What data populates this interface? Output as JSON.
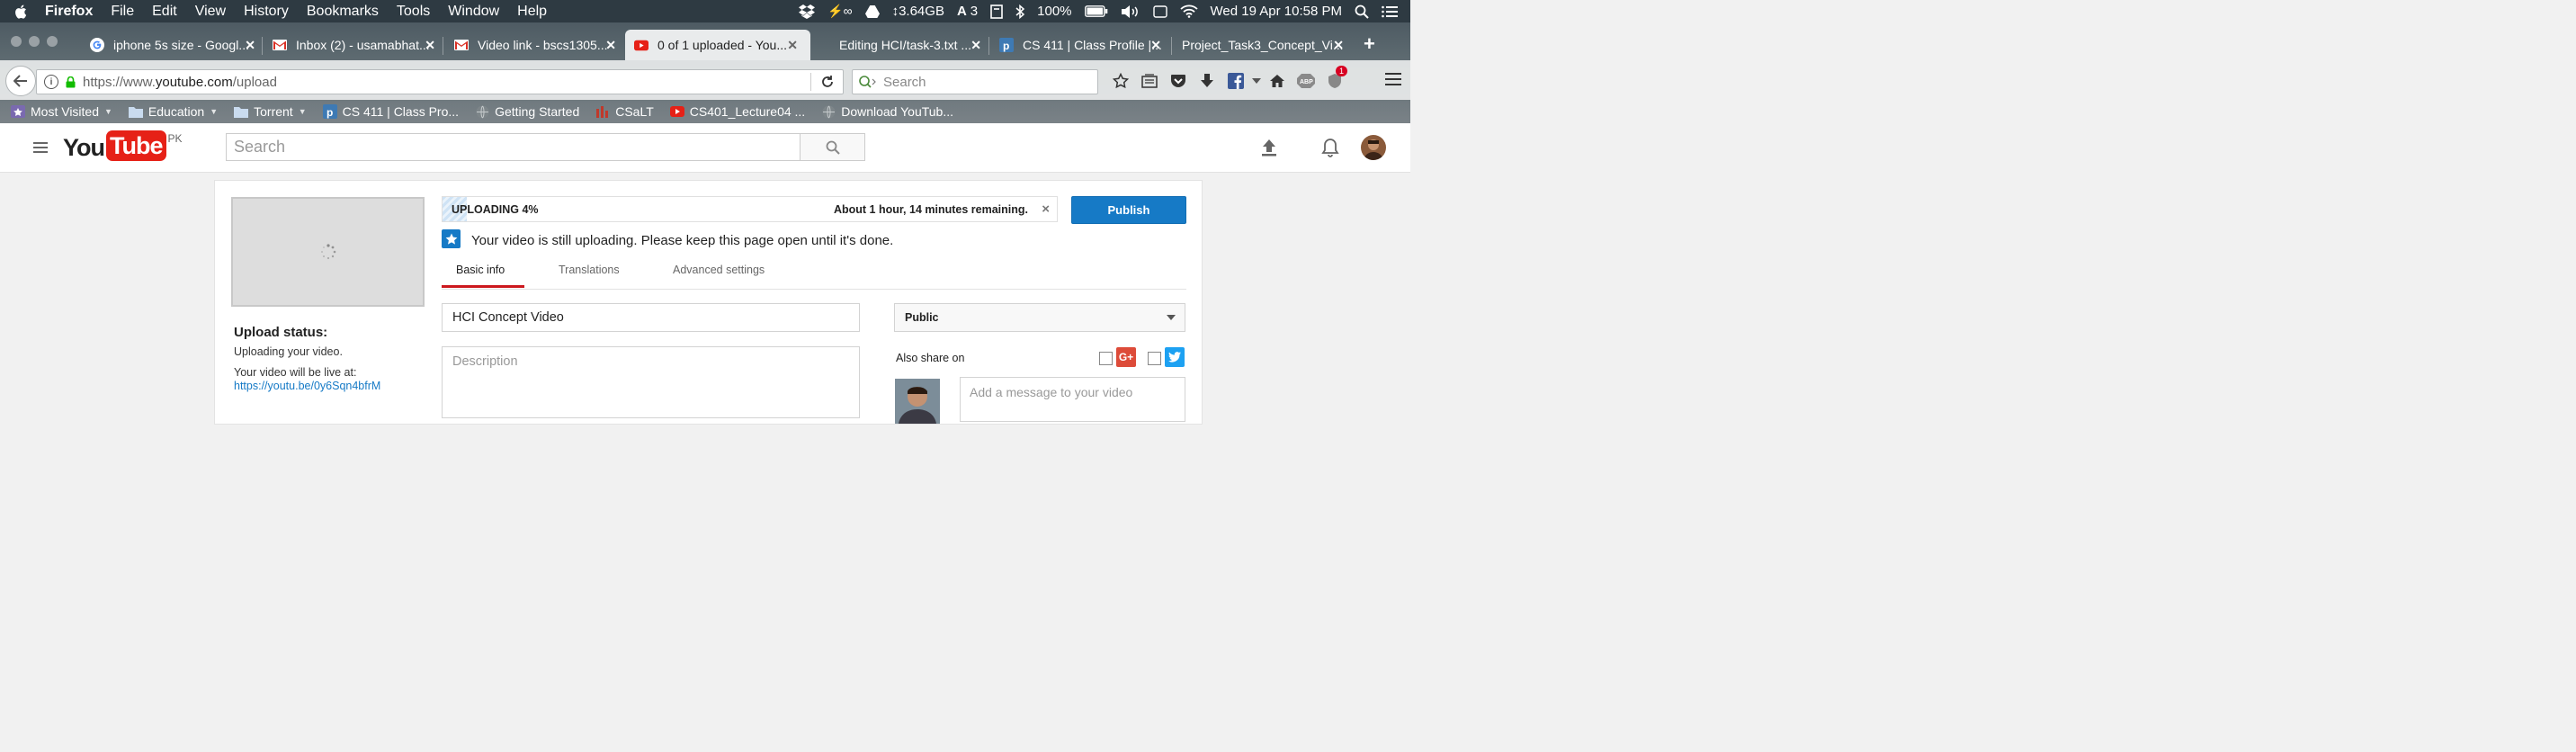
{
  "menubar": {
    "app": "Firefox",
    "items": [
      "File",
      "Edit",
      "View",
      "History",
      "Bookmarks",
      "Tools",
      "Window",
      "Help"
    ],
    "status": {
      "data_rate": "↕3.64GB",
      "adobe_count": "3",
      "battery": "100%",
      "datetime": "Wed 19 Apr  10:58 PM"
    }
  },
  "tabs": [
    {
      "label": "iphone 5s size - Googl...",
      "icon": "google-icon"
    },
    {
      "label": "Inbox (2) - usamabhat...",
      "icon": "gmail-icon"
    },
    {
      "label": "Video link - bscs1305...",
      "icon": "gmail-icon"
    },
    {
      "label": "0 of 1 uploaded - You...",
      "icon": "youtube-icon",
      "active": true
    },
    {
      "label": "Editing HCI/task-3.txt ...",
      "icon": "none"
    },
    {
      "label": "CS 411 | Class Profile |...",
      "icon": "piazza-icon"
    },
    {
      "label": "Project_Task3_Concept_Vi...",
      "icon": "none"
    }
  ],
  "navbar": {
    "url_prefix": "https://www.",
    "url_host": "youtube.com",
    "url_path": "/upload",
    "search_placeholder": "Search",
    "notification_badge": "1"
  },
  "bookmarks": [
    {
      "label": "Most Visited",
      "icon": "most-visited-icon",
      "dropdown": true
    },
    {
      "label": "Education",
      "icon": "folder-icon",
      "dropdown": true
    },
    {
      "label": "Torrent",
      "icon": "folder-icon",
      "dropdown": true
    },
    {
      "label": "CS 411 | Class Pro...",
      "icon": "piazza-icon"
    },
    {
      "label": "Getting Started",
      "icon": "globe-icon"
    },
    {
      "label": "CSaLT",
      "icon": "csalt-icon"
    },
    {
      "label": "CS401_Lecture04 ...",
      "icon": "youtube-icon"
    },
    {
      "label": "Download YouTub...",
      "icon": "globe-icon"
    }
  ],
  "youtube": {
    "logo_you": "You",
    "logo_tube": "Tube",
    "logo_region": "PK",
    "search_placeholder": "Search"
  },
  "upload": {
    "progress_percent": 4,
    "progress_label": "UPLOADING 4%",
    "time_remaining": "About 1 hour, 14 minutes remaining.",
    "publish_label": "Publish",
    "notice": "Your video is still uploading. Please keep this page open until it's done.",
    "status_title": "Upload status:",
    "status_text": "Uploading your video.",
    "live_label": "Your video will be live at:",
    "live_link": "https://youtu.be/0y6Sqn4bfrM",
    "tabs": [
      "Basic info",
      "Translations",
      "Advanced settings"
    ],
    "active_tab": "Basic info",
    "title_value": "HCI Concept Video",
    "description_placeholder": "Description",
    "privacy": "Public",
    "share_label": "Also share on",
    "message_placeholder": "Add a message to your video"
  },
  "colors": {
    "publish_blue": "#167ac6",
    "youtube_red": "#e62117",
    "tab_underline": "#cc181e"
  }
}
